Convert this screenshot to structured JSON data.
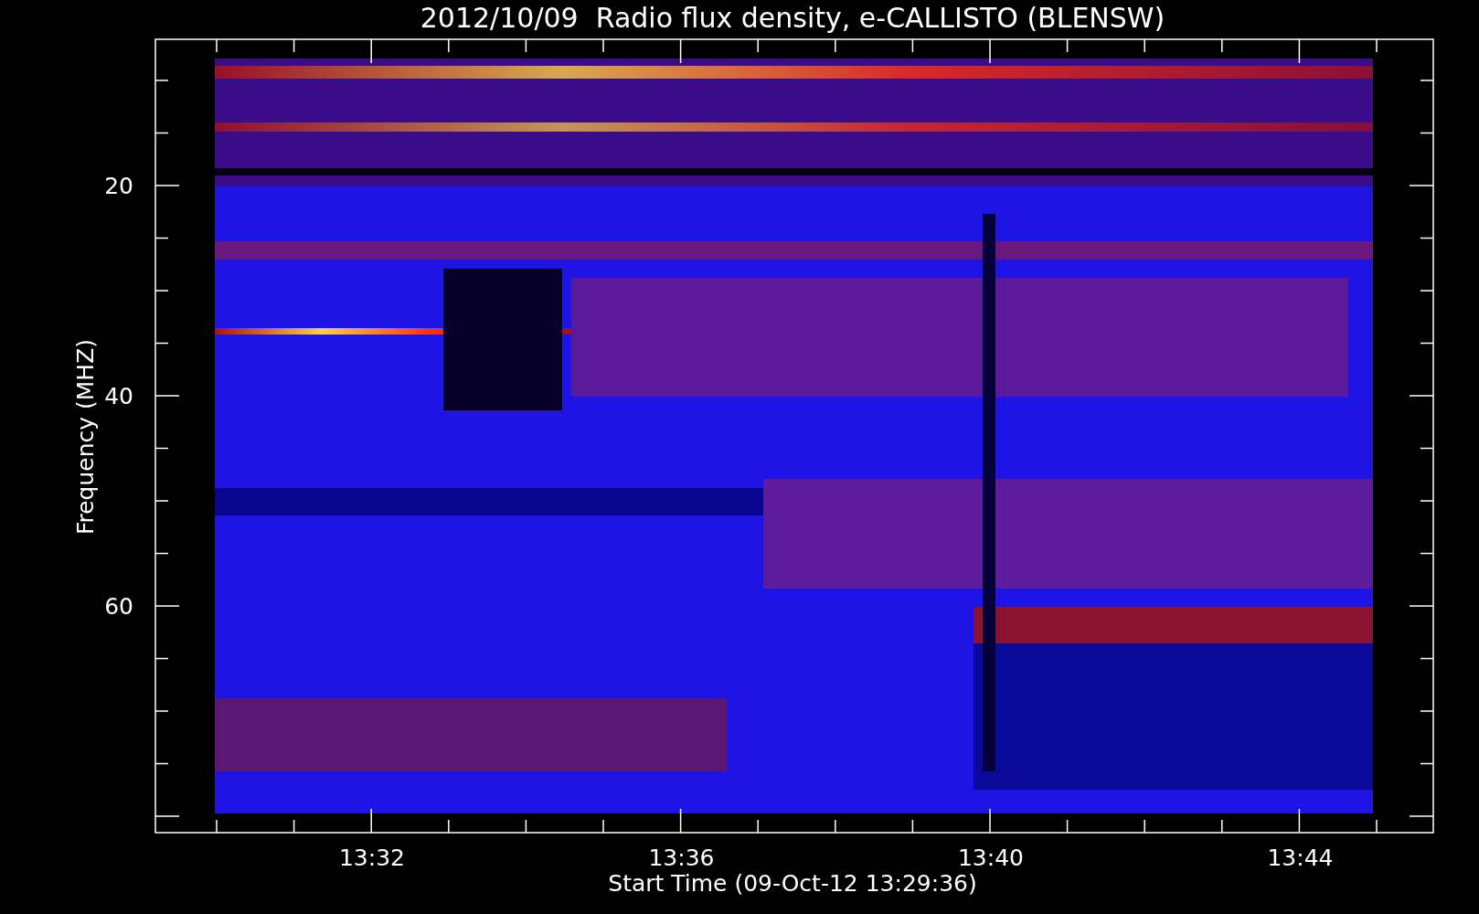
{
  "title": "2012/10/09  Radio flux density, e-CALLISTO (BLENSW)",
  "y_axis": {
    "label": "Frequency (MHZ)",
    "tick_labels": [
      "20",
      "40",
      "60"
    ]
  },
  "x_axis": {
    "label": "Start Time (09-Oct-12 13:29:36)",
    "tick_labels": [
      "13:32",
      "13:36",
      "13:40",
      "13:44"
    ]
  }
}
